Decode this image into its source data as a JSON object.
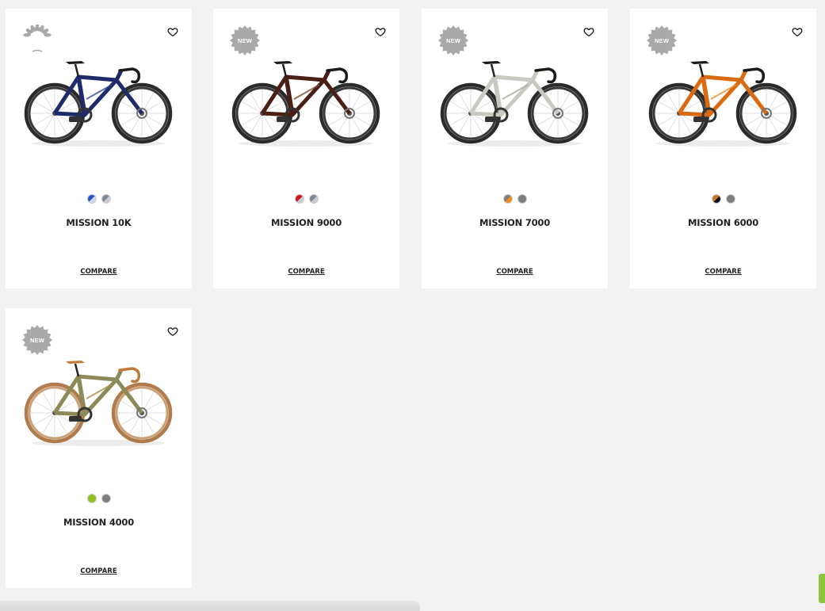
{
  "products": [
    {
      "name": "MISSION 10K",
      "badge": "laurel",
      "badge_label": "",
      "swatches": [
        [
          "#1f55c8",
          "#cfd8e6"
        ],
        [
          "#7a8796",
          "#c9ccd3"
        ]
      ],
      "frame_color": "#1e2a6a",
      "accent_color": "#3a4c9a",
      "compare_label": "COMPARE"
    },
    {
      "name": "MISSION 9000",
      "badge": "new",
      "badge_label": "NEW",
      "swatches": [
        [
          "#d0141b",
          "#c9ccd3"
        ],
        [
          "#7a8796",
          "#c9ccd3"
        ]
      ],
      "frame_color": "#4a1f16",
      "accent_color": "#7a4a30",
      "compare_label": "COMPARE"
    },
    {
      "name": "MISSION 7000",
      "badge": "new",
      "badge_label": "NEW",
      "swatches": [
        [
          "#7d7d7d",
          "#f08c1a"
        ],
        [
          "#7d7d7d",
          "#7d7d7d"
        ]
      ],
      "frame_color": "#c8c9c0",
      "accent_color": "#a8aa9e",
      "compare_label": "COMPARE"
    },
    {
      "name": "MISSION 6000",
      "badge": "new",
      "badge_label": "NEW",
      "swatches": [
        [
          "#c9782a",
          "#111111"
        ],
        [
          "#7d7d7d",
          "#7d7d7d"
        ]
      ],
      "frame_color": "#d96a10",
      "accent_color": "#f08a2a",
      "compare_label": "COMPARE"
    },
    {
      "name": "MISSION 4000",
      "badge": "new",
      "badge_label": "NEW",
      "swatches": [
        [
          "#8dc21f",
          "#8dc21f"
        ],
        [
          "#7d7d7d",
          "#7d7d7d"
        ]
      ],
      "frame_color": "#8d8a5a",
      "accent_color": "#b08a4a",
      "compare_label": "COMPARE"
    }
  ],
  "colors": {
    "page_bg": "#f2f2f2",
    "card_bg": "#ffffff",
    "badge_gray": "#a9a9a9",
    "brand_green": "#8cc63f"
  },
  "icons": {
    "wishlist": "heart-outline-icon",
    "laurel": "laurel-wreath-icon",
    "new": "new-starburst-icon"
  }
}
